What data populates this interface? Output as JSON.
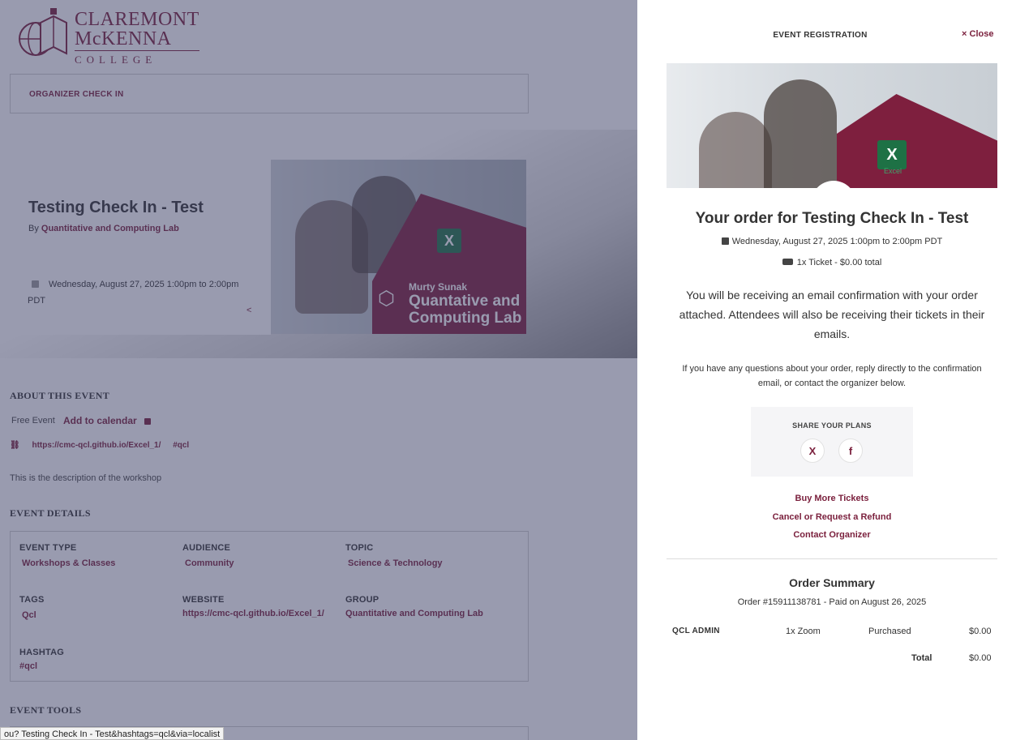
{
  "background": {
    "logo": {
      "line1": "CLAREMONT",
      "line2": "McKENNA",
      "line3": "COLLEGE"
    },
    "organizer_check_in": "ORGANIZER CHECK IN",
    "event": {
      "title": "Testing Check In - Test",
      "by_prefix": "By",
      "organizer": "Quantitative and Computing Lab",
      "date": "Wednesday, August 27, 2025 1:00pm to 2:00pm PDT"
    },
    "image": {
      "subtitle": "Murty Sunak",
      "title_line1": "Quantative and",
      "title_line2": "Computing Lab",
      "excel_letter": "X"
    },
    "about_heading": "ABOUT THIS EVENT",
    "free_event": "Free Event",
    "add_to_calendar": "Add to calendar",
    "link_url": "https://cmc-qcl.github.io/Excel_1/",
    "link_hashtag": "#qcl",
    "description": "This is the description of the workshop",
    "details_heading": "EVENT DETAILS",
    "details": {
      "event_type": {
        "label": "EVENT TYPE",
        "value": "Workshops & Classes"
      },
      "audience": {
        "label": "AUDIENCE",
        "value": "Community"
      },
      "topic": {
        "label": "TOPIC",
        "value": "Science & Technology"
      },
      "tags": {
        "label": "TAGS",
        "value": "Qcl"
      },
      "website": {
        "label": "WEBSITE",
        "value": "https://cmc-qcl.github.io/Excel_1/"
      },
      "group": {
        "label": "GROUP",
        "value": "Quantitative and Computing Lab"
      },
      "hashtag": {
        "label": "HASHTAG",
        "value": "#qcl"
      }
    },
    "tools_heading": "EVENT TOOLS",
    "url_tooltip": "ou? Testing Check In - Test&hashtags=qcl&via=localist"
  },
  "drawer": {
    "title": "EVENT REGISTRATION",
    "close_label": "Close",
    "close_glyph": "×",
    "excel_letter": "X",
    "excel_label": "Excel",
    "order_title": "Your order for Testing Check In - Test",
    "order_date": "Wednesday, August 27, 2025 1:00pm to 2:00pm PDT",
    "ticket_summary": "1x Ticket - $0.00 total",
    "confirmation_text": "You will be receiving an email confirmation with your order attached. Attendees will also be receiving their tickets in their emails.",
    "questions_text": "If you have any questions about your order, reply directly to the confirmation email, or contact the organizer below.",
    "share_title": "SHARE YOUR PLANS",
    "share_x": "X",
    "share_facebook": "f",
    "links": {
      "buy_more": "Buy More Tickets",
      "cancel_refund": "Cancel or Request a Refund",
      "contact": "Contact Organizer"
    },
    "summary": {
      "title": "Order Summary",
      "order_line": "Order #15911138781 - Paid on August 26, 2025",
      "row": {
        "name": "QCL ADMIN",
        "ticket": "1x Zoom",
        "status": "Purchased",
        "price": "$0.00"
      },
      "total_label": "Total",
      "total_value": "$0.00"
    }
  },
  "colors": {
    "accent": "#7a1f3c",
    "overlay": "#3c4066",
    "excel_green": "#1e7145"
  }
}
